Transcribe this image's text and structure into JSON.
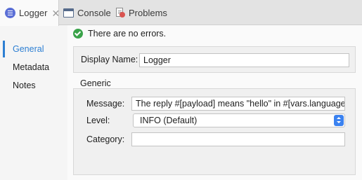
{
  "tabs": [
    {
      "label": "Logger",
      "icon": "logger-icon",
      "active": true,
      "closable": true
    },
    {
      "label": "Console",
      "icon": "console-icon"
    },
    {
      "label": "Problems",
      "icon": "problems-icon"
    }
  ],
  "sidebar": {
    "items": [
      {
        "label": "General",
        "active": true
      },
      {
        "label": "Metadata"
      },
      {
        "label": "Notes"
      }
    ]
  },
  "status": {
    "text": "There are no errors.",
    "icon": "check-circle-icon"
  },
  "form": {
    "display_name": {
      "label": "Display Name:",
      "value": "Logger"
    },
    "generic": {
      "title": "Generic",
      "message": {
        "label": "Message:",
        "value": "The reply #[payload] means \"hello\" in #[vars.language]"
      },
      "level": {
        "label": "Level:",
        "value": "INFO (Default)"
      },
      "category": {
        "label": "Category:",
        "value": ""
      }
    }
  },
  "colors": {
    "accent": "#2d7fd3",
    "success": "#3aa34a",
    "select_button": "#3b82f0"
  }
}
